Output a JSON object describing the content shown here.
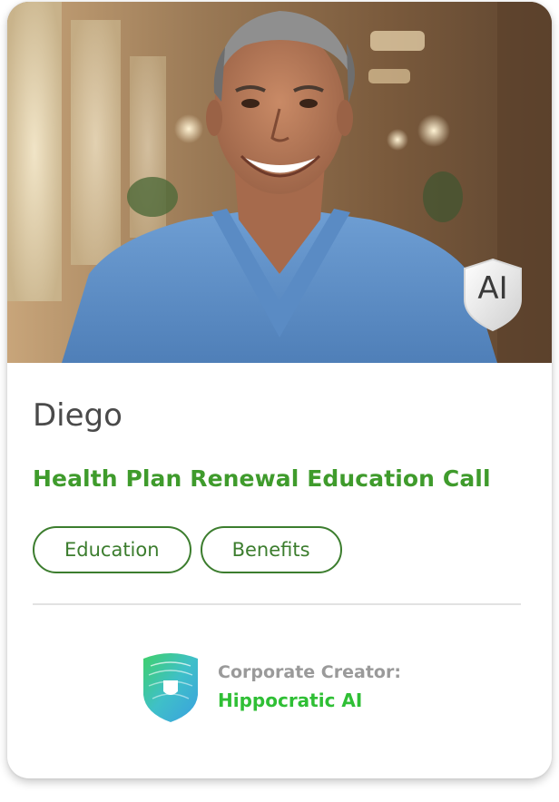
{
  "card": {
    "name": "Diego",
    "title": "Health Plan Renewal Education Call",
    "badge_label": "AI",
    "tags": [
      {
        "label": "Education"
      },
      {
        "label": "Benefits"
      }
    ],
    "creator": {
      "label": "Corporate Creator:",
      "name": "Hippocratic AI"
    }
  },
  "colors": {
    "accent_green": "#3f9b2c",
    "tag_border": "#3c7d2e",
    "creator_green": "#2fbf35",
    "name_text": "#4a4a4a",
    "muted_text": "#9a9a9a"
  },
  "icons": {
    "photo": "person-portrait-photo",
    "badge": "ai-shield-icon",
    "creator_logo": "hippocratic-shield-logo-icon"
  }
}
